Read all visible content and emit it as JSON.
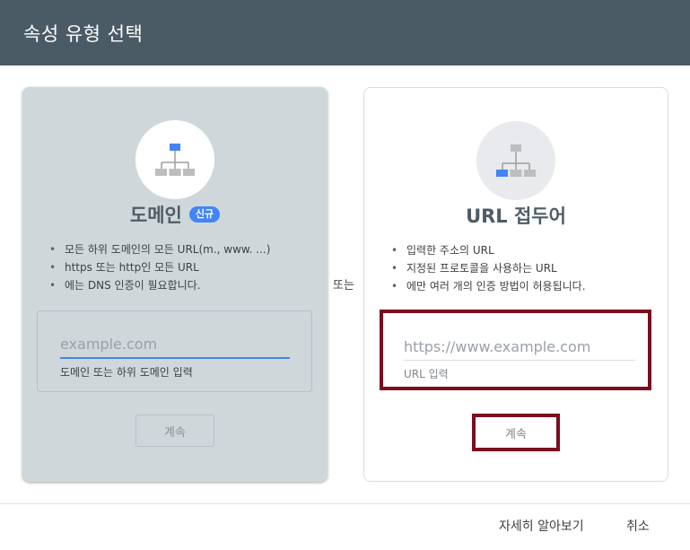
{
  "dialog": {
    "title": "속성 유형 선택"
  },
  "domain_card": {
    "title": "도메인",
    "badge": "신규",
    "features": [
      "모든 하위 도메인의 모든 URL(m., www. ...)",
      "https 또는 http인 모든 URL",
      "에는 DNS 인증이 필요합니다."
    ],
    "input": {
      "placeholder": "example.com",
      "value": "",
      "helper": "도메인 또는 하위 도메인 입력"
    },
    "continue_label": "계속"
  },
  "separator": "또는",
  "url_prefix_card": {
    "title": "URL 접두어",
    "features": [
      "입력한 주소의 URL",
      "지정된 프로토콜을 사용하는 URL",
      "에만 여러 개의 인증 방법이 허용됩니다."
    ],
    "input": {
      "placeholder": "https://www.example.com",
      "value": "",
      "helper": "URL 입력"
    },
    "continue_label": "계속"
  },
  "footer": {
    "learn_more": "자세히 알아보기",
    "cancel": "취소"
  },
  "colors": {
    "header_bg": "#4a5b66",
    "domain_card_bg": "#d0d7db",
    "accent": "#4285f4",
    "highlight_border": "#7b0d1e"
  },
  "icons": {
    "domain": "sitemap-icon",
    "url_prefix": "sitemap-icon"
  }
}
